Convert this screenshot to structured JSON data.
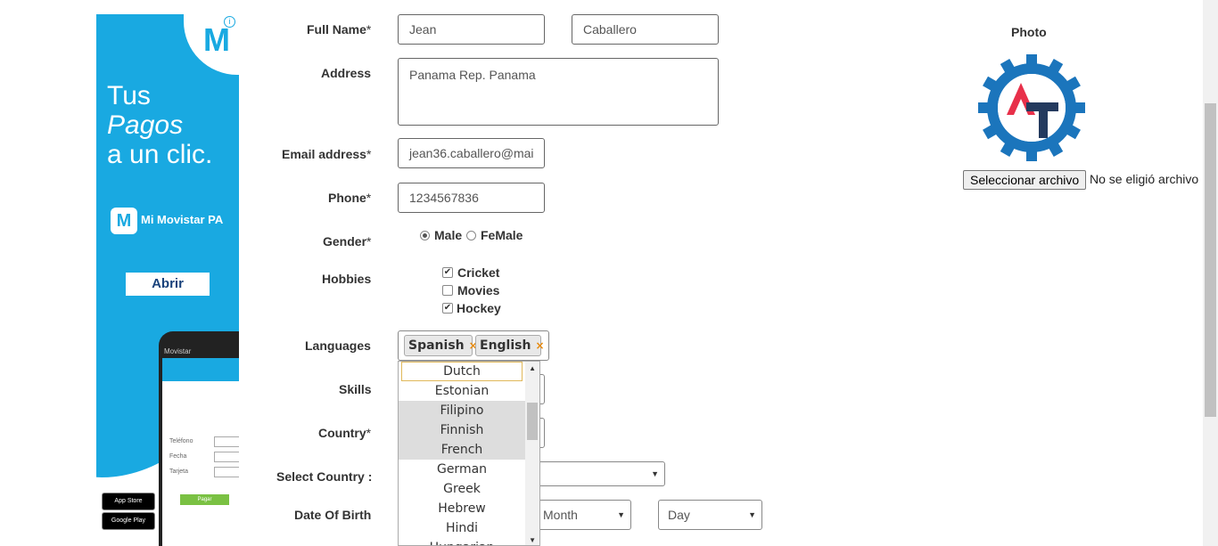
{
  "ad": {
    "line1": "Tus",
    "line2": "Pagos",
    "line3": "a un clic.",
    "app_name": "Mi Movistar PA",
    "open_button": "Abrir",
    "phone_carrier": "Movistar",
    "app_store": "App Store",
    "google_play": "Google Play",
    "screen_rows": [
      "Teléfono",
      "Fecha",
      "Tarjeta"
    ],
    "screen_button": "Pagar"
  },
  "form": {
    "full_name": {
      "label": "Full Name",
      "required": "*",
      "first": "Jean",
      "last": "Caballero"
    },
    "address": {
      "label": "Address",
      "value": "Panama Rep. Panama"
    },
    "email": {
      "label": "Email address",
      "required": "*",
      "value": "jean36.caballero@mai"
    },
    "phone": {
      "label": "Phone",
      "required": "*",
      "value": "1234567836"
    },
    "gender": {
      "label": "Gender",
      "required": "*",
      "options": [
        "Male",
        "FeMale"
      ],
      "selected": "Male"
    },
    "hobbies": {
      "label": "Hobbies",
      "options": [
        {
          "label": "Cricket",
          "checked": true
        },
        {
          "label": "Movies",
          "checked": false
        },
        {
          "label": "Hockey",
          "checked": true
        }
      ]
    },
    "languages": {
      "label": "Languages",
      "selected": [
        "Spanish",
        "English"
      ],
      "dropdown": [
        "Dutch",
        "Estonian",
        "Filipino",
        "Finnish",
        "French",
        "German",
        "Greek",
        "Hebrew",
        "Hindi",
        "Hungarian"
      ],
      "highlighted": "Dutch",
      "selected_in_list": [
        "Filipino",
        "Finnish",
        "French"
      ]
    },
    "skills": {
      "label": "Skills"
    },
    "country": {
      "label": "Country",
      "required": "*"
    },
    "select_country": {
      "label": "Select Country :"
    },
    "dob": {
      "label": "Date Of Birth",
      "month_placeholder": "Month",
      "day_placeholder": "Day"
    },
    "remove_symbol": "×",
    "check_symbol": "✔"
  },
  "photo": {
    "title": "Photo",
    "choose_button": "Seleccionar archivo",
    "status": "No se eligió archivo"
  },
  "colors": {
    "ad_blue": "#19a9e1",
    "logo_blue": "#1b75bc",
    "logo_red": "#e8304a",
    "logo_navy": "#233a5e",
    "tag_x": "#e88a0b"
  }
}
